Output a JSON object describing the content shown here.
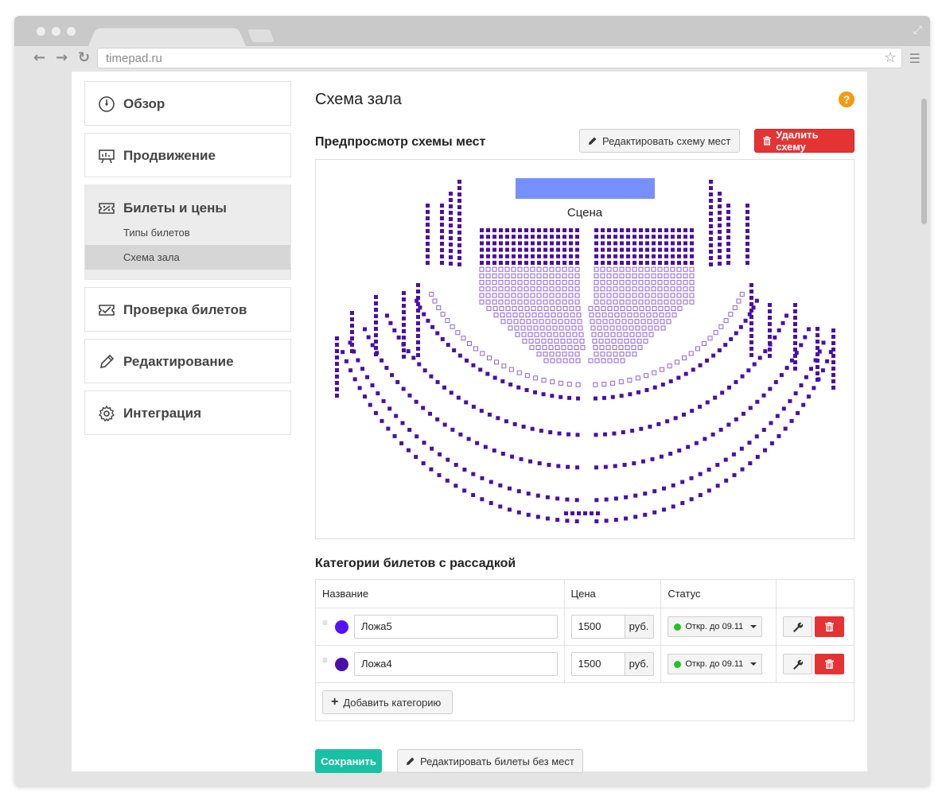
{
  "browser": {
    "url": "timepad.ru"
  },
  "sidebar": {
    "items": [
      {
        "label": "Обзор",
        "icon": "dashboard-icon"
      },
      {
        "label": "Продвижение",
        "icon": "presentation-icon"
      },
      {
        "label": "Билеты и цены",
        "icon": "ticket-icon",
        "active": true,
        "sub": [
          {
            "label": "Типы билетов"
          },
          {
            "label": "Схема зала",
            "selected": true
          }
        ]
      },
      {
        "label": "Проверка билетов",
        "icon": "ticket-check-icon"
      },
      {
        "label": "Редактирование",
        "icon": "pencil-icon"
      },
      {
        "label": "Интеграция",
        "icon": "gear-icon"
      }
    ]
  },
  "main": {
    "title": "Схема зала",
    "preview_title": "Предпросмотр схемы мест",
    "edit_scheme_label": "Редактировать схему мест",
    "delete_scheme_label": "Удалить схему",
    "stage_label": "Сцена",
    "categories_title": "Категории билетов с рассадкой",
    "table": {
      "headers": {
        "name": "Название",
        "price": "Цена",
        "status": "Статус"
      },
      "rows": [
        {
          "name": "Ложа5",
          "price": "1500",
          "unit": "руб.",
          "status": "Откр. до 09.11",
          "color": "#5511ff"
        },
        {
          "name": "Ложа4",
          "price": "1500",
          "unit": "руб.",
          "status": "Откр. до 09.11",
          "color": "#4a0fa8"
        }
      ]
    },
    "add_category_label": "Добавить категорию",
    "save_label": "Сохранить",
    "edit_no_seats_label": "Редактировать билеты без мест"
  },
  "colors": {
    "seat": "#4a0fa8",
    "seat_light": "#8f62d8",
    "stage": "#7790ff",
    "accent": "#19c1a4",
    "danger": "#e53333",
    "help": "#f39a12"
  }
}
